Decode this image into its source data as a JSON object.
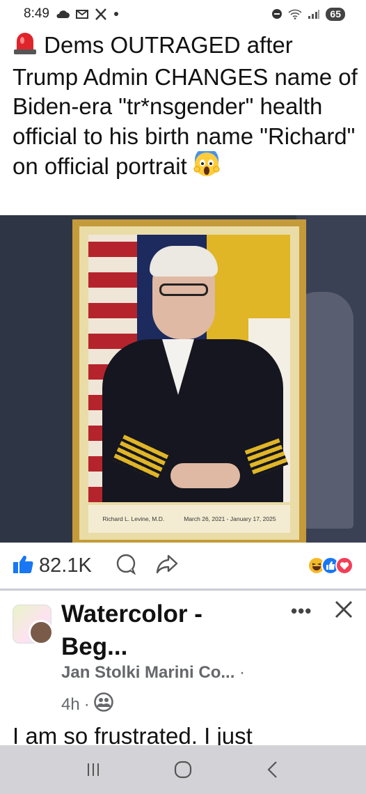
{
  "status_bar": {
    "time": "8:49",
    "left_icons": [
      "cloud-icon",
      "mail-icon",
      "x-app-icon",
      "dot-icon"
    ],
    "right_icons": [
      "do-not-disturb-icon",
      "wifi-icon",
      "signal-icon"
    ],
    "battery": "65"
  },
  "post": {
    "headline_emoji": "siren-emoji",
    "headline": "Dems OUTRAGED after Trump Admin CHANGES name of Biden-era \"tr*nsgender\" health official to his birth name \"Richard\" on official portrait",
    "headline_end_emoji": "screaming-face-emoji",
    "portrait_caption_name": "Richard L. Levine, M.D.",
    "portrait_caption_dates": "March 26, 2021 - January 17, 2025",
    "like_count": "82.1K",
    "reaction_emojis": [
      "laugh-reaction",
      "like-reaction",
      "love-reaction"
    ],
    "colors": {
      "like_blue": "#1877f2",
      "love_red": "#f33e58",
      "haha_yellow": "#f7b928"
    }
  },
  "group_post": {
    "group_name": "Watercolor - Beg...",
    "author": "Jan Stolki Marini Co...",
    "time": "4h",
    "privacy_icon": "friends-icon",
    "text_preview": "I am so frustrated. I just"
  },
  "nav": {
    "buttons": [
      "recent-apps-button",
      "home-button",
      "back-button"
    ]
  }
}
